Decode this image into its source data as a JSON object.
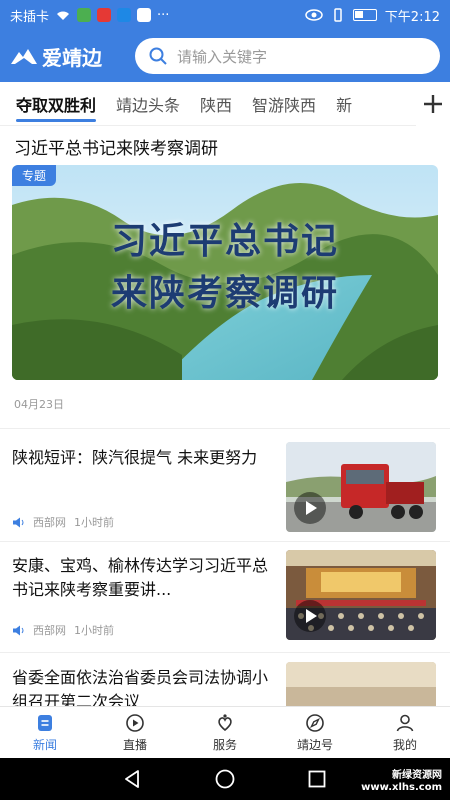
{
  "status_bar": {
    "carrier": "未插卡",
    "time": "下午2:12"
  },
  "header": {
    "logo_text": "爱靖边",
    "search_placeholder": "请输入关键字"
  },
  "tabs": [
    {
      "label": "夺取双胜利",
      "active": true
    },
    {
      "label": "靖边头条",
      "active": false
    },
    {
      "label": "陕西",
      "active": false
    },
    {
      "label": "智游陕西",
      "active": false
    },
    {
      "label": "新",
      "active": false
    }
  ],
  "feature": {
    "title": "习近平总书记来陕考察调研",
    "badge": "专题",
    "image_text_line1": "习近平总书记",
    "image_text_line2": "来陕考察调研",
    "date": "04月23日"
  },
  "news": [
    {
      "title": "陕视短评：陕汽很提气 未来更努力",
      "source": "西部网",
      "time": "1小时前",
      "has_video": true
    },
    {
      "title": "安康、宝鸡、榆林传达学习习近平总书记来陕考察重要讲...",
      "source": "西部网",
      "time": "1小时前",
      "has_video": true
    },
    {
      "title": "省委全面依法治省委员会司法协调小组召开第二次会议",
      "source": "",
      "time": "",
      "has_video": false
    }
  ],
  "bottom_nav": [
    {
      "label": "新闻",
      "icon": "news-icon",
      "active": true
    },
    {
      "label": "直播",
      "icon": "live-icon",
      "active": false
    },
    {
      "label": "服务",
      "icon": "service-icon",
      "active": false
    },
    {
      "label": "靖边号",
      "icon": "compass-icon",
      "active": false
    },
    {
      "label": "我的",
      "icon": "user-icon",
      "active": false
    }
  ],
  "watermark": {
    "line1": "新绿资源网",
    "line2": "www.xlhs.com"
  },
  "colors": {
    "accent": "#3d7fe0"
  }
}
